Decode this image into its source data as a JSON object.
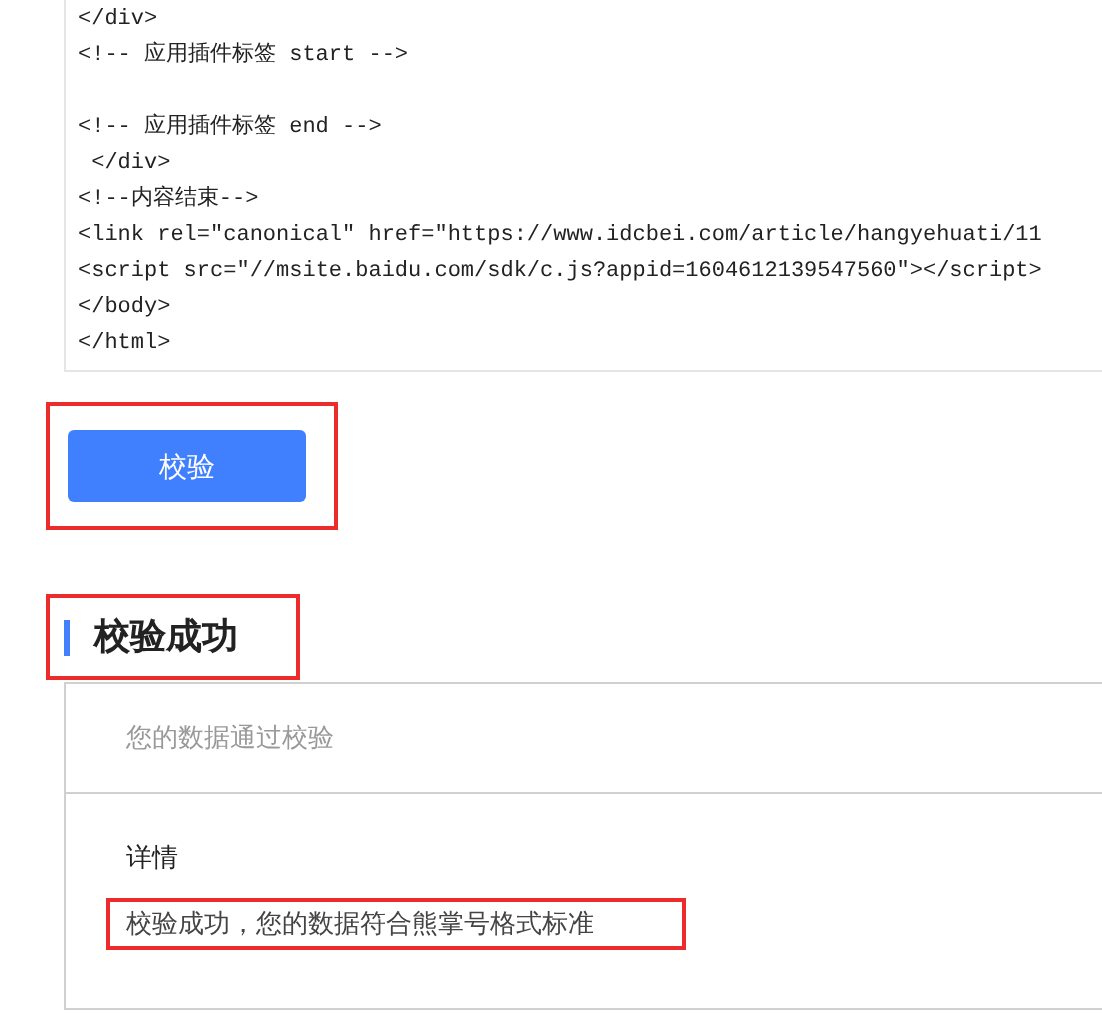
{
  "code_lines": [
    [
      "</div>",
      "<!-- 应用插件标签 start -->"
    ],
    [
      "<!-- 应用插件标签 end -->",
      " </div>",
      "<!--内容结束-->",
      "<link rel=\"canonical\" href=\"https://www.idcbei.com/article/hangyehuati/11",
      "<script src=\"//msite.baidu.com/sdk/c.js?appid=1604612139547560\"></script>",
      "</body>",
      "</html>"
    ]
  ],
  "verify_button": {
    "label": "校验",
    "highlighted": true
  },
  "result": {
    "title": "校验成功",
    "title_highlighted": true,
    "summary": "您的数据通过校验",
    "details_label": "详情",
    "details_text": "校验成功，您的数据符合熊掌号格式标准",
    "details_highlighted": true
  }
}
